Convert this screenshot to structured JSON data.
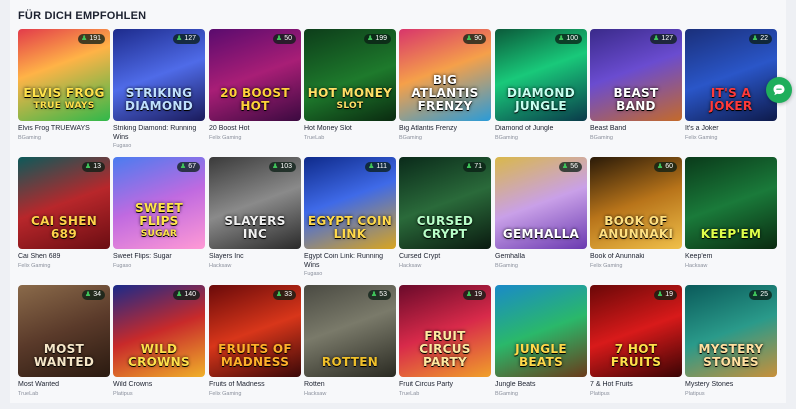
{
  "section_title": "FÜR DICH EMPFOHLEN",
  "rows": [
    [
      {
        "name": "Elvis Frog TRUEWAYS",
        "provider": "BGaming",
        "players": "191",
        "art": "ELVIS FROG",
        "art2": "TRUE WAYS",
        "bg": "linear-gradient(160deg,#e23b4a 0%,#ffb347 40%,#2fb84a 100%)",
        "color": "#ffe14a"
      },
      {
        "name": "Striking Diamond: Running Wins",
        "provider": "Fugaso",
        "players": "127",
        "art": "STRIKING DIAMOND",
        "art2": "",
        "bg": "linear-gradient(160deg,#1d2b8c 0%,#4f6be8 50%,#1a1a5a 100%)",
        "color": "#bfe0ff"
      },
      {
        "name": "20 Boost Hot",
        "provider": "Felix Gaming",
        "players": "50",
        "art": "20 BOOST HOT",
        "art2": "",
        "bg": "linear-gradient(160deg,#5a0b6e 0%,#a81e76 50%,#3b0a40 100%)",
        "color": "#ffd23a"
      },
      {
        "name": "Hot Money Slot",
        "provider": "TrueLab",
        "players": "199",
        "art": "HOT MONEY",
        "art2": "Slot",
        "bg": "linear-gradient(160deg,#0d3d1a 0%,#1e7a2c 55%,#0a2a10 100%)",
        "color": "#ffe066"
      },
      {
        "name": "Big Atlantis Frenzy",
        "provider": "BGaming",
        "players": "90",
        "art": "BIG ATLANTIS FRENZY",
        "art2": "",
        "bg": "linear-gradient(160deg,#d8356b 0%,#f5a04a 45%,#2a9bd8 100%)",
        "color": "#ffffff"
      },
      {
        "name": "Diamond of Jungle",
        "provider": "BGaming",
        "players": "100",
        "art": "DIAMOND JUNGLE",
        "art2": "",
        "bg": "linear-gradient(160deg,#0b5a3a 0%,#19c97a 45%,#0a3a4a 100%)",
        "color": "#c6fff0"
      },
      {
        "name": "Beast Band",
        "provider": "BGaming",
        "players": "127",
        "art": "BEAST BAND",
        "art2": "",
        "bg": "linear-gradient(160deg,#3a2a8a 0%,#6a4cd0 45%,#c46a2a 100%)",
        "color": "#ffffff"
      },
      {
        "name": "It's a Joker",
        "provider": "Felix Gaming",
        "players": "22",
        "art": "IT'S A JOKER",
        "art2": "",
        "bg": "linear-gradient(160deg,#1a2f7a 0%,#2a56c8 50%,#0e1a4a 100%)",
        "color": "#ff3a3a"
      }
    ],
    [
      {
        "name": "Cai Shen 689",
        "provider": "Felix Gaming",
        "players": "13",
        "art": "CAI SHEN 689",
        "art2": "",
        "bg": "linear-gradient(160deg,#0c5a5a 0%,#b8272b 50%,#6a0d12 100%)",
        "color": "#ffd24a"
      },
      {
        "name": "Sweet Flips: Sugar",
        "provider": "Fugaso",
        "players": "67",
        "art": "SWEET FLIPS",
        "art2": "Sugar",
        "bg": "linear-gradient(160deg,#4a7cf0 0%,#c06ae0 50%,#ff9ad5 100%)",
        "color": "#ffe54a"
      },
      {
        "name": "Slayers Inc",
        "provider": "Hacksaw",
        "players": "103",
        "art": "SLAYERS INC",
        "art2": "",
        "bg": "linear-gradient(160deg,#3a3a3a 0%,#8a8a8a 50%,#2a2a2a 100%)",
        "color": "#f0f0f0"
      },
      {
        "name": "Egypt Coin Link: Running Wins",
        "provider": "Fugaso",
        "players": "111",
        "art": "EGYPT COIN LINK",
        "art2": "",
        "bg": "linear-gradient(160deg,#0e2a8a 0%,#3f6ae8 45%,#d9a520 100%)",
        "color": "#ffd94a"
      },
      {
        "name": "Cursed Crypt",
        "provider": "Hacksaw",
        "players": "71",
        "art": "CURSED CRYPT",
        "art2": "",
        "bg": "linear-gradient(160deg,#0a2a1a 0%,#2a6a3a 50%,#0a1a10 100%)",
        "color": "#b8ffc8"
      },
      {
        "name": "Gemhalla",
        "provider": "BGaming",
        "players": "56",
        "art": "GEMHALLA",
        "art2": "",
        "bg": "linear-gradient(160deg,#d9b84a 0%,#c9a0e8 50%,#6a3ab0 100%)",
        "color": "#ffffff"
      },
      {
        "name": "Book of Anunnaki",
        "provider": "Felix Gaming",
        "players": "60",
        "art": "BOOK OF ANUNNAKI",
        "art2": "",
        "bg": "linear-gradient(160deg,#2a1a08 0%,#b8741a 50%,#f0c04a 100%)",
        "color": "#ffe080"
      },
      {
        "name": "Keep'em",
        "provider": "Hacksaw",
        "players": "",
        "art": "KEEP'EM",
        "art2": "",
        "bg": "linear-gradient(160deg,#0a3a1a 0%,#1a7a3a 50%,#0a2a10 100%)",
        "color": "#e0ff4a"
      }
    ],
    [
      {
        "name": "Most Wanted",
        "provider": "TrueLab",
        "players": "34",
        "art": "MOST WANTED",
        "art2": "",
        "bg": "linear-gradient(160deg,#8a6a4a 0%,#5a3a2a 50%,#2a1a10 100%)",
        "color": "#f5e6c8"
      },
      {
        "name": "Wild Crowns",
        "provider": "Platipus",
        "players": "140",
        "art": "WILD CROWNS",
        "art2": "",
        "bg": "linear-gradient(160deg,#1a2a8a 0%,#c82a2a 50%,#f0b02a 100%)",
        "color": "#ffe04a"
      },
      {
        "name": "Fruits of Madness",
        "provider": "Felix Gaming",
        "players": "33",
        "art": "FRUITS OF MADNESS",
        "art2": "",
        "bg": "linear-gradient(160deg,#6a0a0a 0%,#d8361a 50%,#3a0808 100%)",
        "color": "#ffb02a"
      },
      {
        "name": "Rotten",
        "provider": "Hacksaw",
        "players": "53",
        "art": "ROTTEN",
        "art2": "",
        "bg": "linear-gradient(160deg,#4a4a42 0%,#7a7a6a 45%,#2a2a22 100%)",
        "color": "#f0c02a"
      },
      {
        "name": "Fruit Circus Party",
        "provider": "TrueLab",
        "players": "19",
        "art": "FRUIT CIRCUS PARTY",
        "art2": "",
        "bg": "linear-gradient(160deg,#6a0a2a 0%,#d82a4a 50%,#f0a02a 100%)",
        "color": "#ffe8a0"
      },
      {
        "name": "Jungle Beats",
        "provider": "BGaming",
        "players": "",
        "art": "JUNGLE BEATS",
        "art2": "",
        "bg": "linear-gradient(160deg,#1a8ac8 0%,#2ab86a 50%,#6a3a1a 100%)",
        "color": "#ffd94a"
      },
      {
        "name": "7 & Hot Fruits",
        "provider": "Platipus",
        "players": "19",
        "art": "7 HOT FRUITS",
        "art2": "",
        "bg": "linear-gradient(160deg,#6a0808 0%,#d81a1a 50%,#3a0404 100%)",
        "color": "#ffe04a"
      },
      {
        "name": "Mystery Stones",
        "provider": "Platipus",
        "players": "25",
        "art": "MYSTERY STONES",
        "art2": "",
        "bg": "linear-gradient(160deg,#0a5a5a 0%,#2a9a8a 50%,#c8903a 100%)",
        "color": "#ffe0a0"
      }
    ]
  ],
  "colors": {
    "accent": "#1fae5b",
    "text": "#1d2230",
    "muted": "#8a8f9c"
  },
  "icons": {
    "players": "people-icon",
    "chat": "chat-icon"
  }
}
